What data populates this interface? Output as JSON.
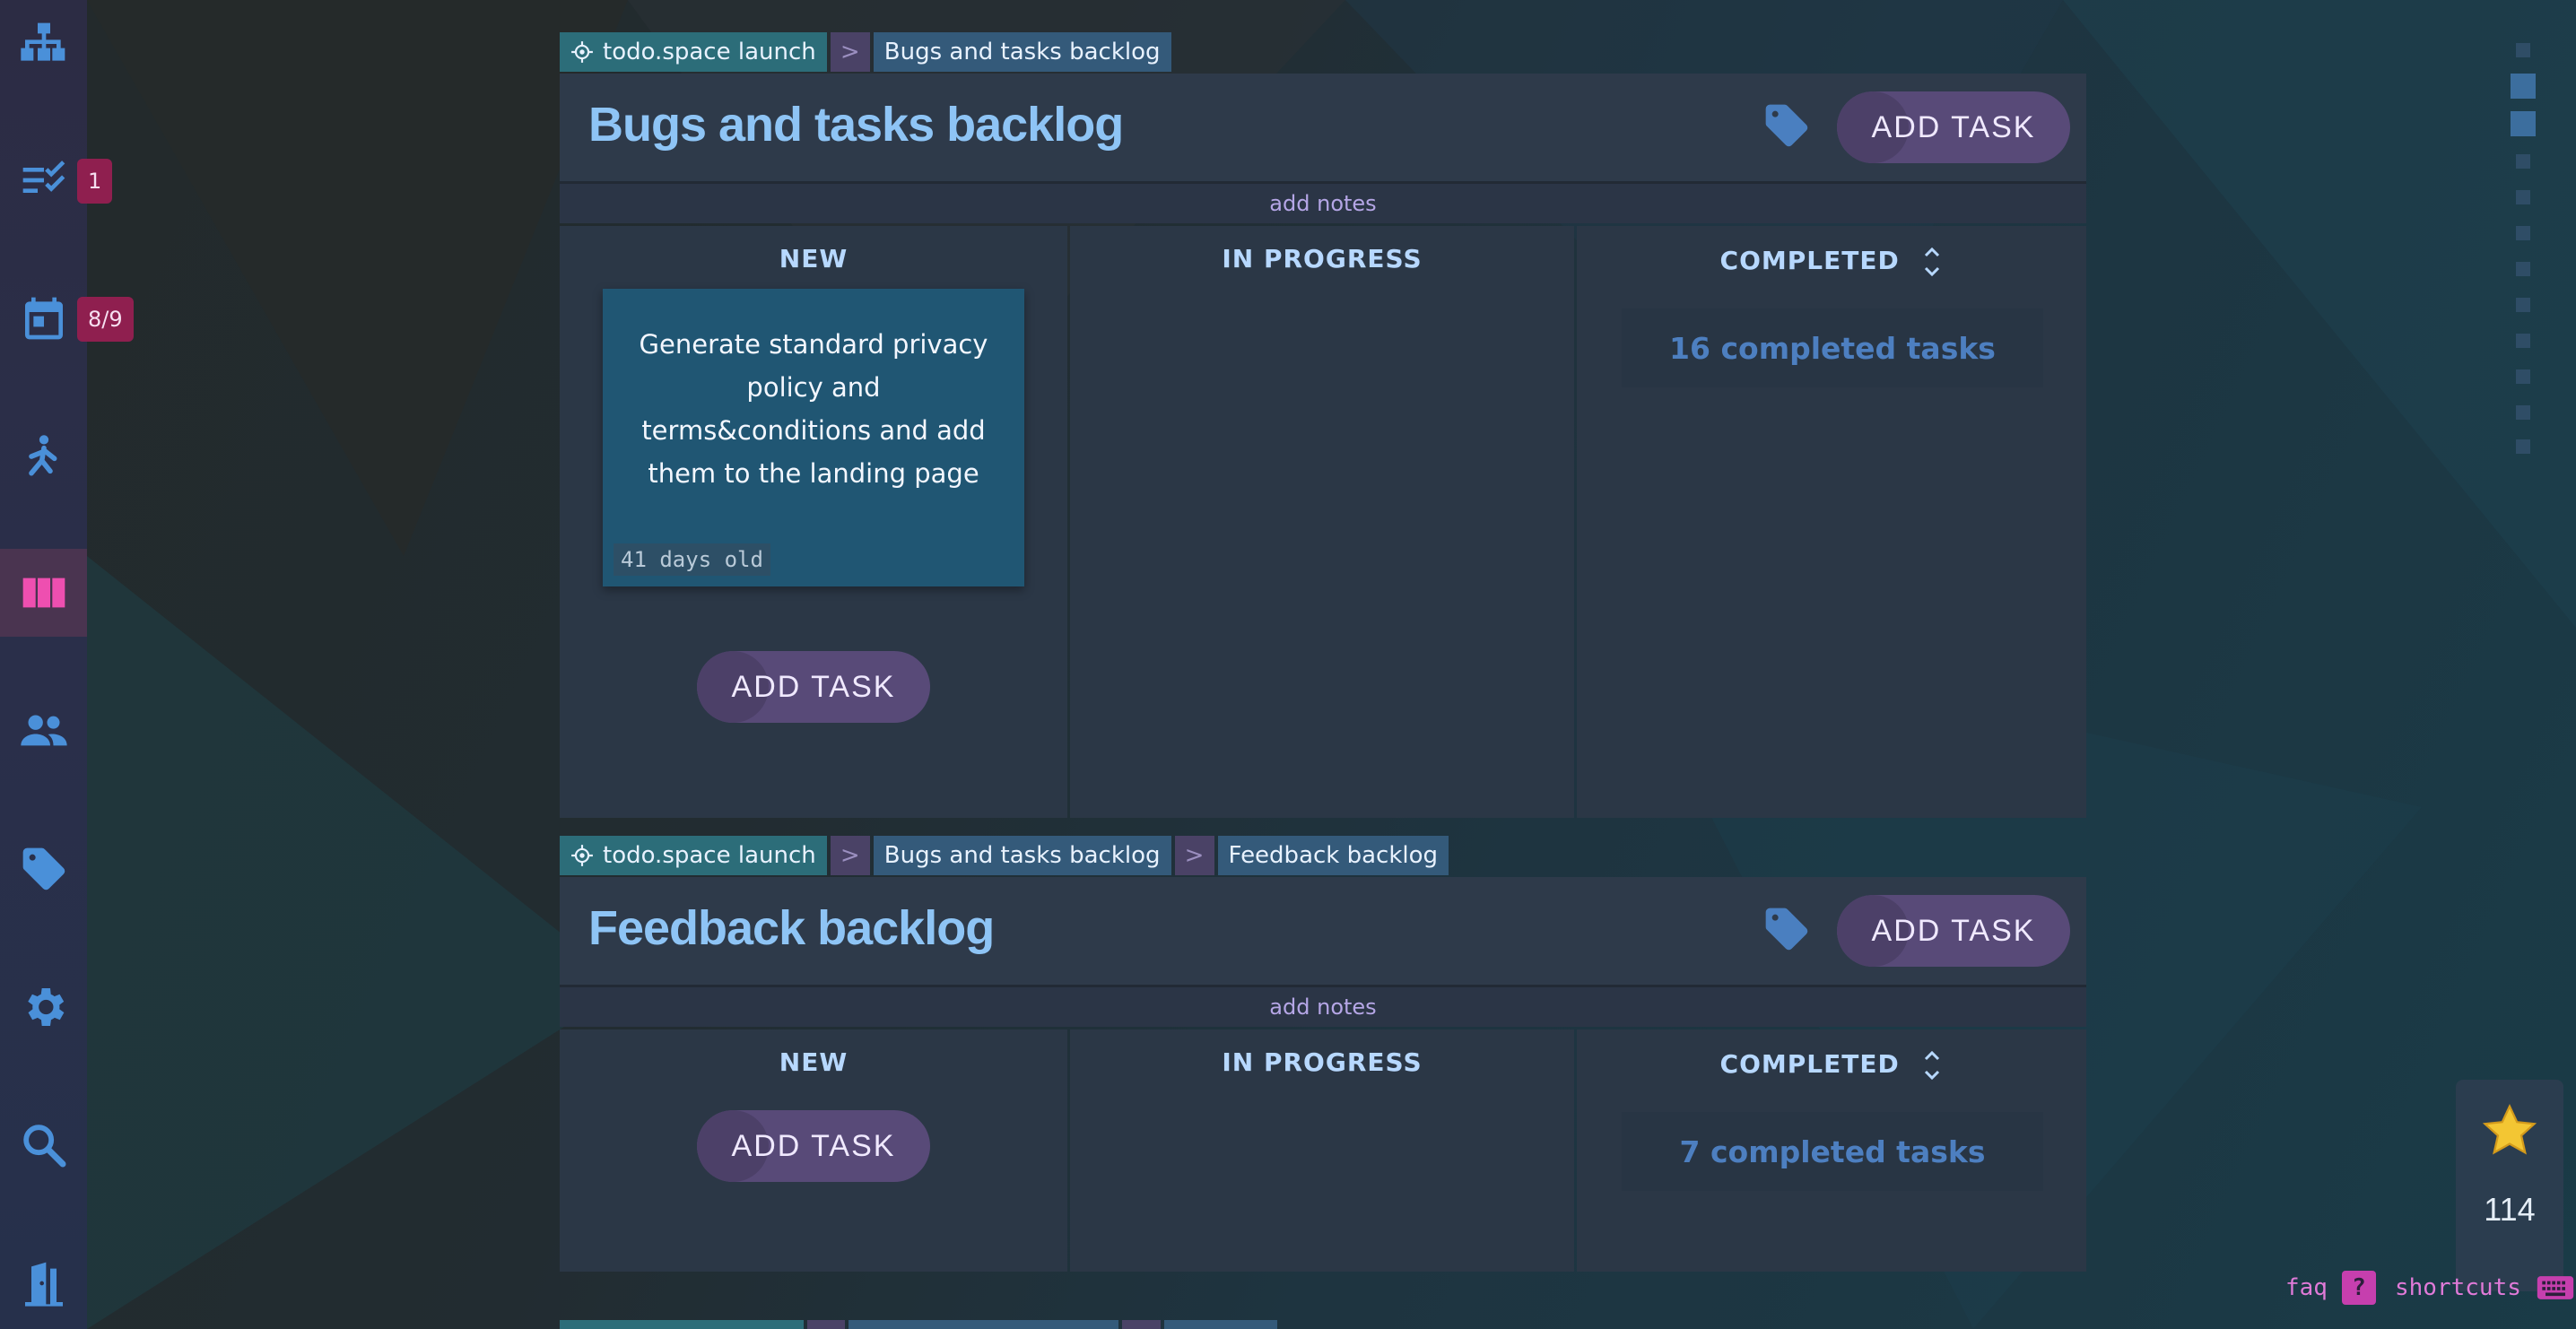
{
  "sidebar": {
    "items": [
      {
        "name": "sitemap-icon",
        "badge": ""
      },
      {
        "name": "checklist-icon",
        "badge": "1"
      },
      {
        "name": "calendar-icon",
        "badge": "8/9"
      },
      {
        "name": "runner-icon",
        "badge": ""
      },
      {
        "name": "kanban-icon",
        "badge": "",
        "active": true
      },
      {
        "name": "people-icon",
        "badge": ""
      },
      {
        "name": "tag-icon",
        "badge": ""
      },
      {
        "name": "gear-icon",
        "badge": ""
      },
      {
        "name": "search-icon",
        "badge": ""
      },
      {
        "name": "exit-door-icon",
        "badge": ""
      }
    ]
  },
  "boards": [
    {
      "breadcrumbs": [
        "todo.space launch",
        "Bugs and tasks backlog"
      ],
      "title": "Bugs and tasks backlog",
      "add_task": "ADD TASK",
      "notes_label": "add notes",
      "columns": {
        "new": "NEW",
        "in_progress": "IN PROGRESS",
        "completed": "COMPLETED"
      },
      "card": {
        "text": "Generate standard privacy policy and terms&conditions and add them to the landing page",
        "age": "41 days old"
      },
      "completed_summary": "16 completed tasks"
    },
    {
      "breadcrumbs": [
        "todo.space launch",
        "Bugs and tasks backlog",
        "Feedback backlog"
      ],
      "title": "Feedback backlog",
      "add_task": "ADD TASK",
      "notes_label": "add notes",
      "columns": {
        "new": "NEW",
        "in_progress": "IN PROGRESS",
        "completed": "COMPLETED"
      },
      "completed_summary": "7 completed tasks"
    }
  ],
  "star": {
    "count": "114"
  },
  "footer": {
    "faq": "faq",
    "faq_icon": "?",
    "shortcuts": "shortcuts"
  },
  "colors": {
    "accent": "#8ec4f5",
    "badge": "#8f1f4f",
    "link": "#e07ad8",
    "active_nav": "#ee4fb0"
  }
}
